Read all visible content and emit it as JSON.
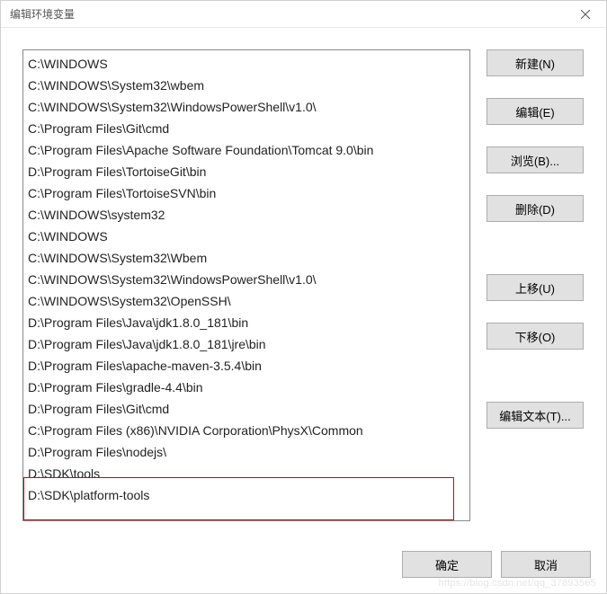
{
  "window": {
    "title": "编辑环境变量"
  },
  "list": {
    "items": [
      "C:\\WINDOWS",
      "C:\\WINDOWS\\System32\\wbem",
      "C:\\WINDOWS\\System32\\WindowsPowerShell\\v1.0\\",
      "C:\\Program Files\\Git\\cmd",
      "C:\\Program Files\\Apache Software Foundation\\Tomcat 9.0\\bin",
      "D:\\Program Files\\TortoiseGit\\bin",
      "C:\\Program Files\\TortoiseSVN\\bin",
      "C:\\WINDOWS\\system32",
      "C:\\WINDOWS",
      "C:\\WINDOWS\\System32\\Wbem",
      "C:\\WINDOWS\\System32\\WindowsPowerShell\\v1.0\\",
      "C:\\WINDOWS\\System32\\OpenSSH\\",
      "D:\\Program Files\\Java\\jdk1.8.0_181\\bin",
      "D:\\Program Files\\Java\\jdk1.8.0_181\\jre\\bin",
      "D:\\Program Files\\apache-maven-3.5.4\\bin",
      "D:\\Program Files\\gradle-4.4\\bin",
      "D:\\Program Files\\Git\\cmd",
      "C:\\Program Files (x86)\\NVIDIA Corporation\\PhysX\\Common",
      "D:\\Program Files\\nodejs\\",
      "D:\\SDK\\tools",
      "D:\\SDK\\platform-tools"
    ]
  },
  "buttons": {
    "new": "新建(N)",
    "edit": "编辑(E)",
    "browse": "浏览(B)...",
    "delete": "删除(D)",
    "moveup": "上移(U)",
    "movedown": "下移(O)",
    "edittext": "编辑文本(T)...",
    "ok": "确定",
    "cancel": "取消"
  },
  "watermark": "https://blog.csdn.net/qq_37893565"
}
